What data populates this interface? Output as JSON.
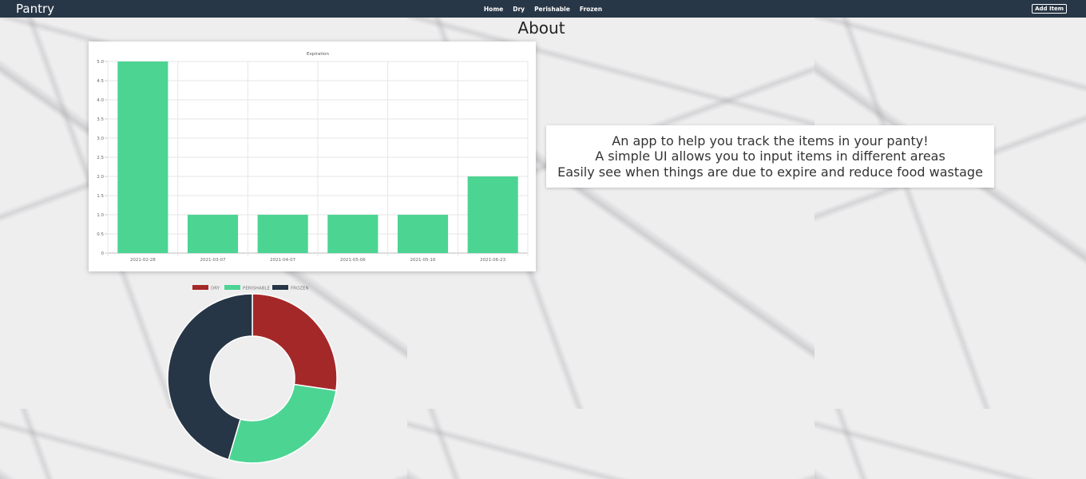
{
  "nav": {
    "brand": "Pantry",
    "links": [
      "Home",
      "Dry",
      "Perishable",
      "Frozen"
    ],
    "add_button": "Add Item",
    "background_color": "#283747"
  },
  "page": {
    "title": "About"
  },
  "about": {
    "lines": [
      "An app to help you track the items in your panty!",
      "A simple UI allows you to input items in different areas",
      "Easily see when things are due to expire and reduce food wastage"
    ]
  },
  "chart_data": [
    {
      "type": "bar",
      "title": "Expiration",
      "categories": [
        "2021-02-28",
        "2021-03-07",
        "2021-04-07",
        "2021-05-06",
        "2021-05-16",
        "2021-06-23"
      ],
      "values": [
        5,
        1,
        1,
        1,
        1,
        2
      ],
      "ylim": [
        0,
        5
      ],
      "yticks": [
        "0",
        "0.5",
        "1.0",
        "1.5",
        "2.0",
        "2.5",
        "3.0",
        "3.5",
        "4.0",
        "4.5",
        "5.0"
      ],
      "grid": true,
      "bar_color": "#4cd493"
    },
    {
      "type": "pie",
      "categories": [
        "DRY",
        "PERISHABLE",
        "FROZEN"
      ],
      "values": [
        3,
        3,
        5
      ],
      "colors": [
        "#a52829",
        "#4cd493",
        "#263646"
      ],
      "legend_position": "top"
    }
  ]
}
